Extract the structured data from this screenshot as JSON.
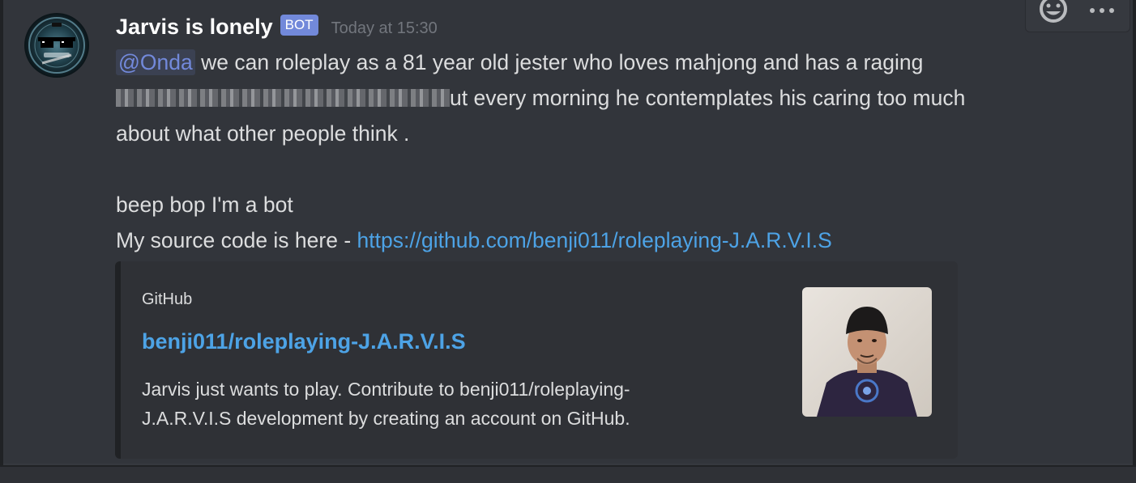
{
  "message": {
    "author": "Jarvis is lonely",
    "bot_tag": "BOT",
    "timestamp": "Today at 15:30",
    "mention": "@Onda",
    "line1_rest": " we can roleplay as a 81 year old jester who loves mahjong and has a raging",
    "line2_rest": "ut every morning he contemplates his caring too much",
    "line3": "about what other people think .",
    "line4": "beep bop I'm a bot",
    "line5_prefix": "My source code is here - ",
    "source_link": "https://github.com/benji011/roleplaying-J.A.R.V.I.S"
  },
  "embed": {
    "provider": "GitHub",
    "title": "benji011/roleplaying-J.A.R.V.I.S",
    "description_line1": "Jarvis just wants to play. Contribute to benji011/roleplaying-",
    "description_line2": "J.A.R.V.I.S development by creating an account on GitHub."
  },
  "icons": {
    "toolbar_react": "add-reaction-icon",
    "toolbar_more": "more-options-icon",
    "avatar": "bot-avatar-jarvis",
    "thumbnail": "github-user-photo"
  },
  "colors": {
    "background": "#36393f",
    "message_hover": "#32353b",
    "bot_tag": "#7289da",
    "link": "#4da3e6",
    "mention": "#7289da",
    "timestamp": "#72767d",
    "embed_bg": "#2f3136"
  }
}
